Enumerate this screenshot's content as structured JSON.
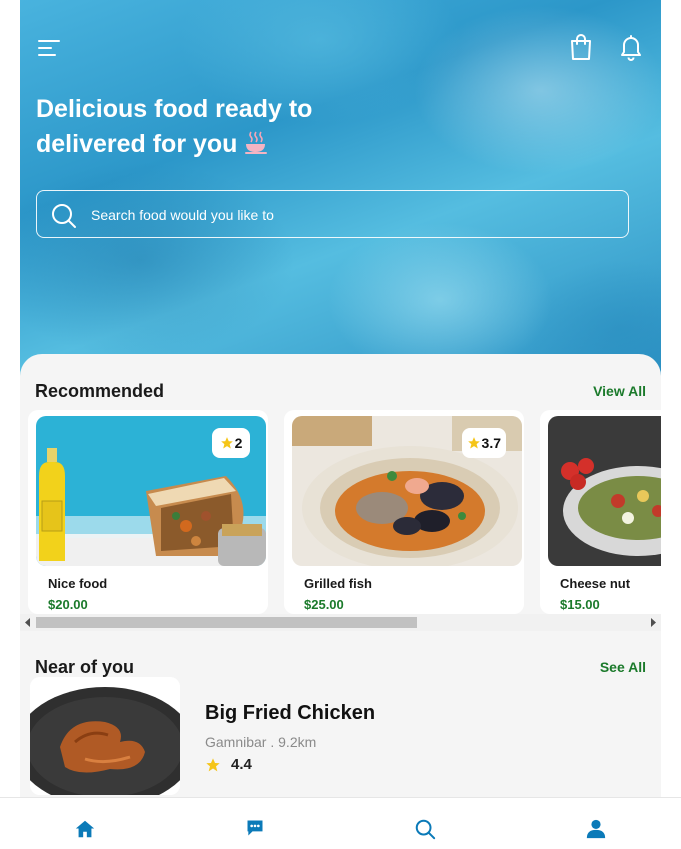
{
  "header": {
    "menu_icon": "menu-icon",
    "bag_icon": "shopping-bag-icon",
    "bell_icon": "bell-icon",
    "title_line1": "Delicious food ready to",
    "title_line2": "delivered for you"
  },
  "search": {
    "placeholder": "Search food would you like to",
    "icon": "search-icon"
  },
  "recommended": {
    "title": "Recommended",
    "view_all": "View All",
    "items": [
      {
        "name": "Nice food",
        "price": "$20.00",
        "rating": "2"
      },
      {
        "name": "Grilled fish",
        "price": "$25.00",
        "rating": "3.7"
      },
      {
        "name": "Cheese nut",
        "price": "$15.00"
      }
    ]
  },
  "near": {
    "title": "Near of you",
    "see_all": "See All",
    "item": {
      "name": "Big Fried Chicken",
      "meta": "Gamnibar . 9.2km",
      "rating": "4.4"
    }
  },
  "bottom_nav": {
    "items": [
      "home-icon",
      "chat-icon",
      "search-icon",
      "profile-icon"
    ]
  },
  "colors": {
    "accent_green": "#1b7a2b",
    "nav_blue": "#0b7ab8",
    "star": "#f5c518"
  }
}
